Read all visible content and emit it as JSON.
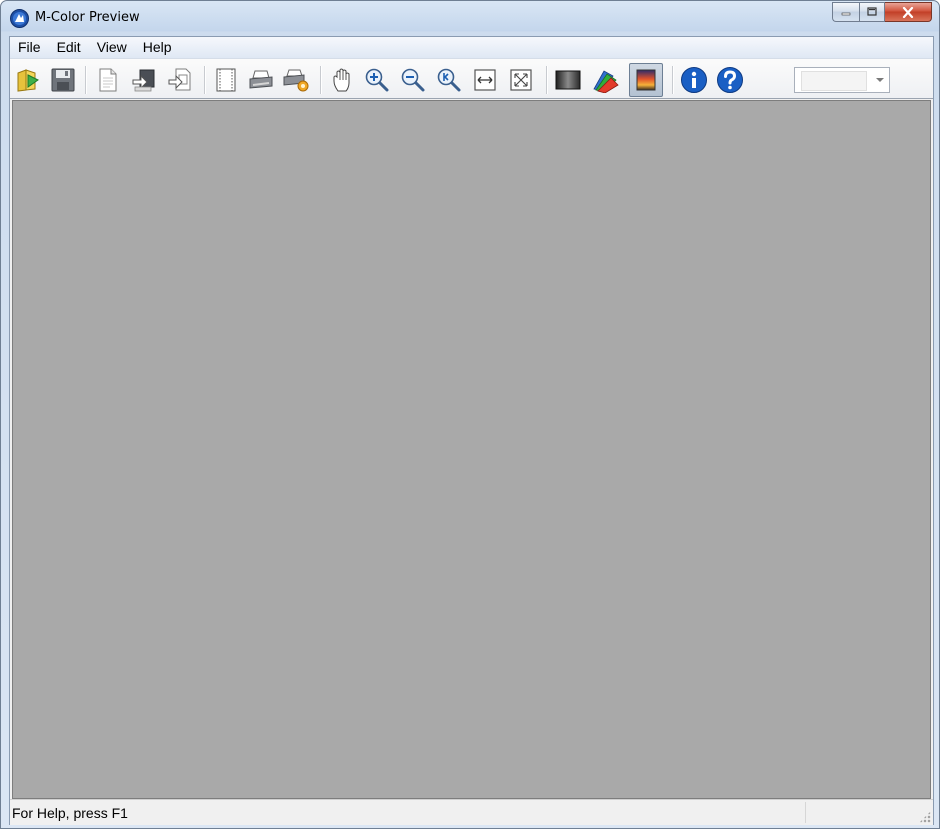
{
  "window": {
    "title": "M-Color Preview",
    "minimize_glyph": "–",
    "maximize_glyph": "▢",
    "close_glyph": "✕"
  },
  "menubar": {
    "items": [
      {
        "label": "File"
      },
      {
        "label": "Edit"
      },
      {
        "label": "View"
      },
      {
        "label": "Help"
      }
    ]
  },
  "toolbar": {
    "buttons": [
      {
        "icon": "open-folder-icon"
      },
      {
        "icon": "save-icon"
      },
      {
        "icon": "new-page-icon"
      },
      {
        "icon": "import-icon"
      },
      {
        "icon": "export-icon"
      },
      {
        "icon": "page-frame-icon"
      },
      {
        "icon": "printer-icon"
      },
      {
        "icon": "printer-settings-icon"
      },
      {
        "icon": "hand-pan-icon"
      },
      {
        "icon": "zoom-in-icon"
      },
      {
        "icon": "zoom-out-icon"
      },
      {
        "icon": "zoom-actual-icon"
      },
      {
        "icon": "fit-width-icon"
      },
      {
        "icon": "fit-page-icon"
      },
      {
        "icon": "grayscale-icon"
      },
      {
        "icon": "color-palette-icon"
      },
      {
        "icon": "color-preview-icon",
        "active": true
      },
      {
        "icon": "info-icon"
      },
      {
        "icon": "help-icon"
      }
    ],
    "zoom_select": {
      "value": ""
    }
  },
  "statusbar": {
    "text": "For Help, press F1"
  },
  "colors": {
    "viewport_bg": "#a9a9a9",
    "info_blue": "#1a5fc4",
    "close_red": "#c8452d"
  }
}
